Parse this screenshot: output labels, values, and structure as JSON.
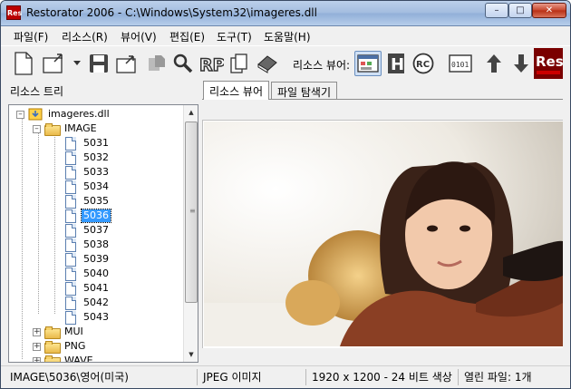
{
  "window": {
    "title": "Restorator 2006 - C:\\Windows\\System32\\imageres.dll",
    "app_icon_text": "Res",
    "controls": {
      "minimize": "–",
      "maximize": "□",
      "close": "✕"
    }
  },
  "menu": {
    "items": [
      "파일(F)",
      "리소스(R)",
      "뷰어(V)",
      "편집(E)",
      "도구(T)",
      "도움말(H)"
    ]
  },
  "toolbar": {
    "viewer_label": "리소스 뷰어:",
    "buttons": [
      "new-file-icon",
      "open-file-icon",
      "dropdown-arrow-icon",
      "save-icon",
      "open-folder-icon",
      "extract-icon",
      "find-icon",
      "rp-icon",
      "copy-pages-icon",
      "book-icon",
      "view-image-icon",
      "hex-h-icon",
      "rc-icon",
      "binary-icon",
      "arrow-up-icon",
      "arrow-down-icon",
      "res-logo-icon"
    ],
    "rp_text": "RP",
    "rc_text": "RC",
    "h_text": "H",
    "bin_text": "0101",
    "logo_text": "Res"
  },
  "panels": {
    "tree_caption": "리소스 트리",
    "tabs": [
      "리소스 뷰어",
      "파일 탐색기"
    ]
  },
  "tree": {
    "root": "imageres.dll",
    "folder_image": "IMAGE",
    "items": [
      "5031",
      "5032",
      "5033",
      "5034",
      "5035",
      "5036",
      "5037",
      "5038",
      "5039",
      "5040",
      "5041",
      "5042",
      "5043"
    ],
    "selected": "5036",
    "other_folders": [
      "MUI",
      "PNG",
      "WAVE"
    ]
  },
  "status": {
    "path": "IMAGE\\5036\\영어(미국)",
    "type": "JPEG 이미지",
    "dimensions": "1920 x 1200 - 24 비트 색상",
    "open_files": "열린 파일: 1개"
  },
  "colors": {
    "titlebar": "#a2bcdf",
    "selection": "#3399ff",
    "window_bg": "#f0f0f0"
  }
}
